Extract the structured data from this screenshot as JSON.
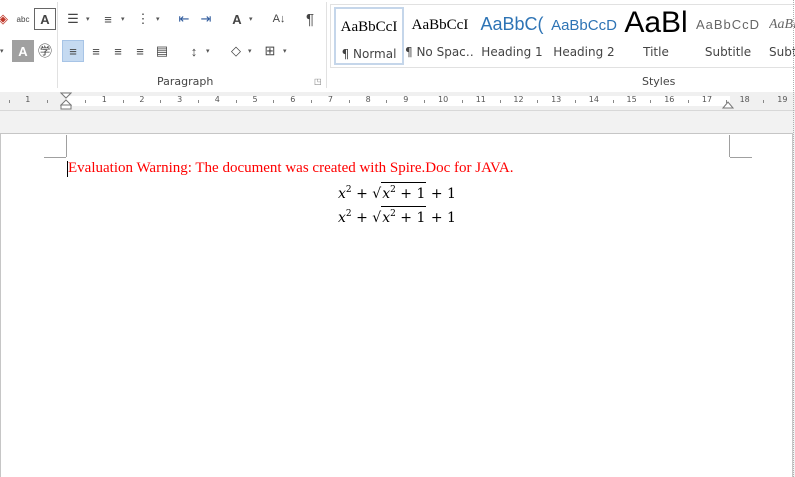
{
  "ribbon": {
    "groups": {
      "paragraph_label": "Paragraph",
      "styles_label": "Styles"
    },
    "font_tools": [
      {
        "name": "clear-format-icon",
        "glyph": "◈"
      },
      {
        "name": "phonetic-guide-icon",
        "glyph": "abc"
      },
      {
        "name": "character-border-icon",
        "glyph": "A"
      },
      {
        "name": "character-shading-icon",
        "glyph": "A"
      },
      {
        "name": "enclose-characters-icon",
        "glyph": "㊫"
      }
    ],
    "paragraph_tools": {
      "bullets_glyph": "☰",
      "numbering_glyph": "≡",
      "multilevel_glyph": "⋮",
      "decrease_indent_glyph": "⇤",
      "increase_indent_glyph": "⇥",
      "asian_layout_glyph": "A",
      "sort_glyph": "A↓",
      "show_marks_glyph": "¶",
      "align_left_glyph": "≡",
      "center_glyph": "≡",
      "align_right_glyph": "≡",
      "justify_glyph": "≡",
      "distributed_glyph": "▤",
      "line_spacing_glyph": "↕",
      "shading_glyph": "◇",
      "borders_glyph": "⊞"
    },
    "styles": [
      {
        "sample": "AaBbCcI",
        "label": "¶ Normal",
        "active": true
      },
      {
        "sample": "AaBbCcI",
        "label": "¶ No Spac…",
        "active": false
      },
      {
        "sample": "AaBbC(",
        "label": "Heading 1",
        "active": false
      },
      {
        "sample": "AaBbCcD",
        "label": "Heading 2",
        "active": false
      },
      {
        "sample": "AaBl",
        "label": "Title",
        "active": false
      },
      {
        "sample": "AaBbCcD",
        "label": "Subtitle",
        "active": false
      },
      {
        "sample": "AaBl",
        "label": "Subtl",
        "active": false
      }
    ],
    "colors": {
      "heading_blue": "#2e74b5",
      "selected_bg": "#c5daf1"
    }
  },
  "ruler": {
    "left_numbers": [
      "1"
    ],
    "right_numbers": [
      "1",
      "2",
      "3",
      "4",
      "5",
      "6",
      "7",
      "8",
      "9",
      "10",
      "11",
      "12",
      "13",
      "14",
      "15",
      "16",
      "17",
      "18",
      "19"
    ]
  },
  "document": {
    "warning": "Evaluation Warning: The document was created with Spire.Doc for JAVA.",
    "warning_color": "#ff0000",
    "equations": [
      {
        "base": "x",
        "exp": "2",
        "op1": "+",
        "rad_base": "x",
        "rad_exp": "2",
        "rad_op": "+",
        "rad_const": "1",
        "op2": "+",
        "const": "1"
      },
      {
        "base": "x",
        "exp": "2",
        "op1": "+",
        "rad_base": "x",
        "rad_exp": "2",
        "rad_op": "+",
        "rad_const": "1",
        "op2": "+",
        "const": "1"
      }
    ]
  }
}
